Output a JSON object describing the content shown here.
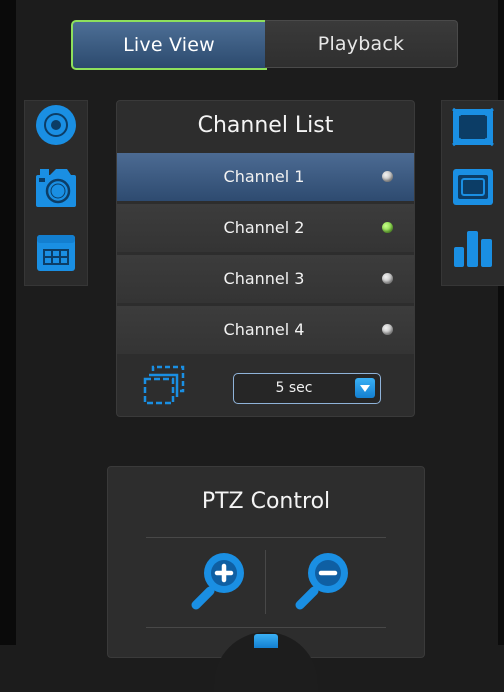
{
  "tabs": {
    "live_view": "Live View",
    "playback": "Playback"
  },
  "left_toolbar": [
    {
      "icon": "record-disc-icon"
    },
    {
      "icon": "camera-snapshot-icon"
    },
    {
      "icon": "calendar-grid-icon"
    }
  ],
  "right_toolbar": [
    {
      "icon": "fullscreen-icon"
    },
    {
      "icon": "aspect-ratio-icon"
    },
    {
      "icon": "bar-chart-icon"
    }
  ],
  "channel_list": {
    "title": "Channel List",
    "channels": [
      {
        "label": "Channel 1",
        "status": "gray",
        "selected": true
      },
      {
        "label": "Channel 2",
        "status": "green",
        "selected": false
      },
      {
        "label": "Channel 3",
        "status": "gray",
        "selected": false
      },
      {
        "label": "Channel 4",
        "status": "gray",
        "selected": false
      }
    ],
    "cycle_interval": "5 sec"
  },
  "ptz": {
    "title": "PTZ Control"
  },
  "colors": {
    "accent_blue": "#1a8fe3",
    "active_tab_border": "#8de05c",
    "selected_row": "#3d5c82",
    "status_green": "#6fd12a"
  }
}
